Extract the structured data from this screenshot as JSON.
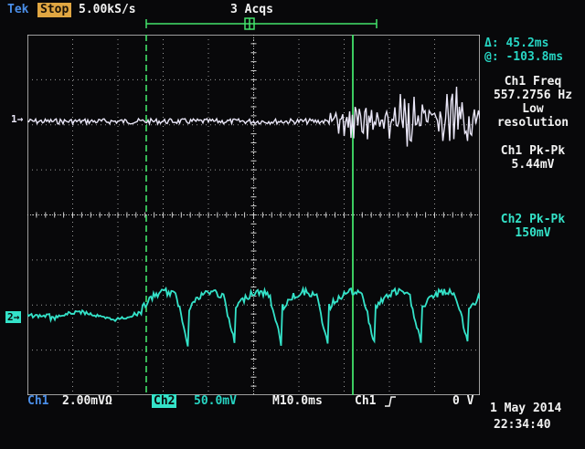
{
  "top": {
    "brand": "Tek",
    "run_state": "Stop",
    "sample_rate": "5.00kS/s",
    "acquisitions": "3 Acqs"
  },
  "cursor": {
    "delta_label": "Δ: 45.2ms",
    "at_label": "@: -103.8ms"
  },
  "measurements": [
    {
      "title": "Ch1 Freq",
      "line1": "557.2756 Hz",
      "line2": "Low",
      "line3": "resolution"
    },
    {
      "title": "Ch1 Pk-Pk",
      "line1": "5.44mV"
    },
    {
      "title": "Ch2 Pk-Pk",
      "line1": "150mV"
    }
  ],
  "channel_markers": {
    "ch1": "1→",
    "ch2": "2→"
  },
  "bottom": {
    "ch1_label": "Ch1",
    "ch1_scale": "2.00mVΩ",
    "ch2_label": "Ch2",
    "ch2_scale": "50.0mV",
    "timebase": "M10.0ms",
    "trigger_source": "Ch1",
    "trigger_level": "0 V",
    "date": "1 May 2014",
    "time": "22:34:40"
  },
  "colors": {
    "ch1_trace": "#e9e6f7",
    "ch2_trace": "#34e3c9",
    "cursor": "#43e36a",
    "graticule": "#cfcfcf",
    "blue_text": "#4a8ee8",
    "stop_badge": "#e0a642"
  }
}
